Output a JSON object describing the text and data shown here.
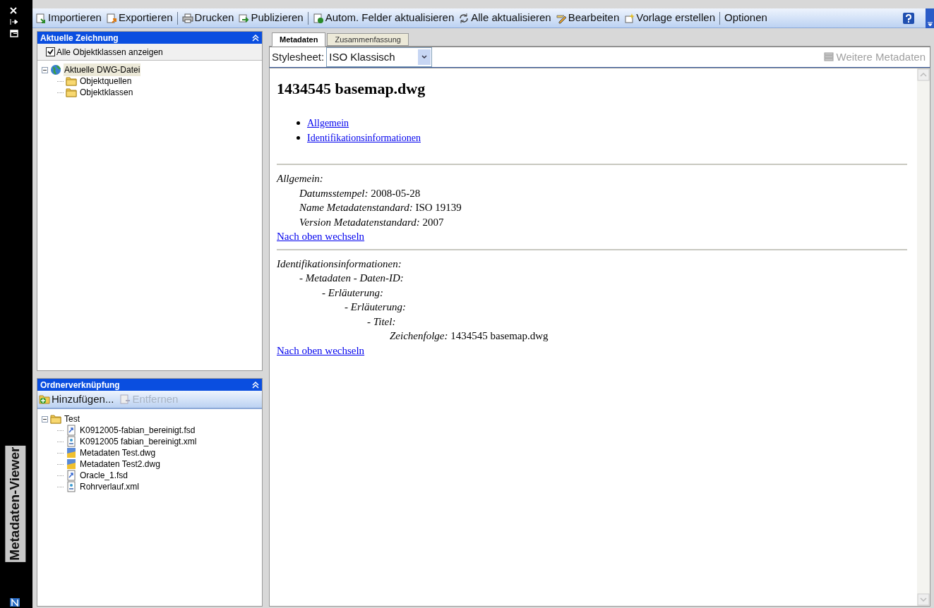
{
  "side_title": "Metadaten-Viewer",
  "toolbar": [
    {
      "label": "Importieren",
      "kind": "import"
    },
    {
      "label": "Exportieren",
      "kind": "export"
    },
    {
      "kind": "separator"
    },
    {
      "label": "Drucken",
      "kind": "print"
    },
    {
      "label": "Publizieren",
      "kind": "publish"
    },
    {
      "kind": "separator"
    },
    {
      "label": "Autom. Felder aktualisieren",
      "kind": "auto"
    },
    {
      "label": "Alle aktualisieren",
      "kind": "refresh"
    },
    {
      "label": "Bearbeiten",
      "kind": "edit"
    },
    {
      "label": "Vorlage erstellen",
      "kind": "template"
    },
    {
      "kind": "separator"
    },
    {
      "label": "Optionen",
      "kind": "text"
    }
  ],
  "drawing_panel": {
    "title": "Aktuelle Zeichnung",
    "show_all": {
      "label": "Alle Objektklassen anzeigen",
      "checked": true
    },
    "tree": [
      {
        "label": "Aktuelle DWG-Datei",
        "kind": "globe",
        "selected": true,
        "expanded": true,
        "children": [
          {
            "label": "Objektquellen",
            "kind": "folder",
            "selected": false
          },
          {
            "label": "Objektklassen",
            "kind": "folder",
            "selected": false
          }
        ]
      }
    ]
  },
  "folder_panel": {
    "title": "Ordnerverknüpfung",
    "buttons": [
      {
        "label": "Hinzufügen...",
        "disabled": false
      },
      {
        "label": "Entfernen",
        "disabled": true
      }
    ],
    "tree": [
      {
        "label": "Test",
        "kind": "folder",
        "selected": false,
        "expanded": true,
        "children": [
          {
            "label": "K0912005-fabian_bereinigt.fsd",
            "kind": "fsd",
            "selected": false
          },
          {
            "label": "K0912005 fabian_bereinigt.xml",
            "kind": "xml",
            "selected": false
          },
          {
            "label": "Metadaten Test.dwg",
            "kind": "dwg",
            "selected": false
          },
          {
            "label": "Metadaten Test2.dwg",
            "kind": "dwg",
            "selected": false
          },
          {
            "label": "Oracle_1.fsd",
            "kind": "fsd",
            "selected": false
          },
          {
            "label": "Rohrverlauf.xml",
            "kind": "xml",
            "selected": false
          }
        ]
      }
    ]
  },
  "tabs": [
    {
      "label": "Metadaten",
      "selected": true
    },
    {
      "label": "Zusammenfassung",
      "selected": false
    }
  ],
  "stylesheet": {
    "label": "Stylesheet:",
    "value": "ISO Klassisch"
  },
  "more_button": {
    "label": "Weitere Metadaten",
    "disabled": true
  },
  "document": {
    "title": "1434545 basemap.dwg",
    "links": [
      "Allgemein",
      "Identifikationsinformationen"
    ],
    "sections": [
      {
        "heading": "Allgemein:",
        "items": [
          {
            "label": "Datumsstempel:",
            "value": "2008-05-28"
          },
          {
            "label": "Name Metadatenstandard:",
            "value": "ISO 19139"
          },
          {
            "label": "Version Metadatenstandard:",
            "value": "2007"
          }
        ],
        "back_link": "Nach oben wechseln"
      },
      {
        "heading": "Identifikationsinformationen:",
        "items": [
          {
            "label": "- Metadaten - Daten-ID:",
            "children": [
              {
                "label": "- Erläuterung:",
                "children": [
                  {
                    "label": "- Erläuterung:",
                    "children": [
                      {
                        "label": "- Titel:",
                        "children": [
                          {
                            "label": "Zeichenfolge:",
                            "value": "1434545 basemap.dwg"
                          }
                        ]
                      }
                    ]
                  }
                ]
              }
            ]
          }
        ],
        "back_link": "Nach oben wechseln"
      }
    ]
  }
}
